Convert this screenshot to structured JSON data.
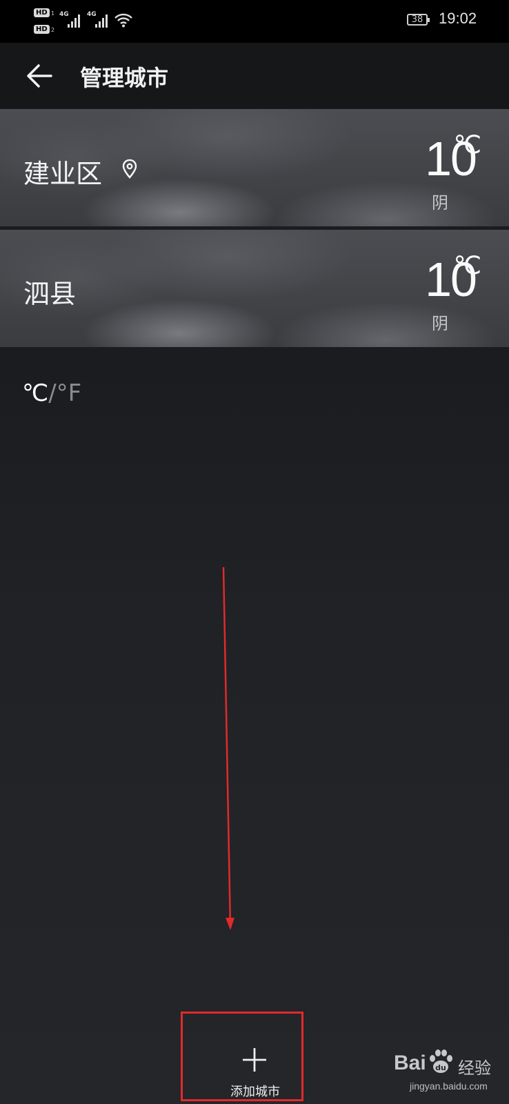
{
  "status_bar": {
    "hd1": "HD",
    "hd1_sub": "1",
    "hd2": "HD",
    "hd2_sub": "2",
    "net1": "4G",
    "net2": "4G",
    "battery": "38",
    "time": "19:02"
  },
  "app_bar": {
    "back_icon": "arrow-left-icon",
    "title": "管理城市"
  },
  "cities": [
    {
      "name": "建业区",
      "is_current_location": true,
      "temperature": "10",
      "unit": "℃",
      "condition": "阴"
    },
    {
      "name": "泗县",
      "is_current_location": false,
      "temperature": "10",
      "unit": "℃",
      "condition": "阴"
    }
  ],
  "unit_toggle": {
    "celsius": "℃",
    "separator": "/",
    "fahrenheit": "°F",
    "selected": "celsius"
  },
  "add_city": {
    "icon": "plus-icon",
    "label": "添加城市"
  },
  "annotation": {
    "arrow_color": "#e22a2a",
    "box_color": "#e22a2a"
  },
  "watermark": {
    "brand": "Bai",
    "brand_suffix": "经验",
    "url": "jingyan.baidu.com"
  }
}
